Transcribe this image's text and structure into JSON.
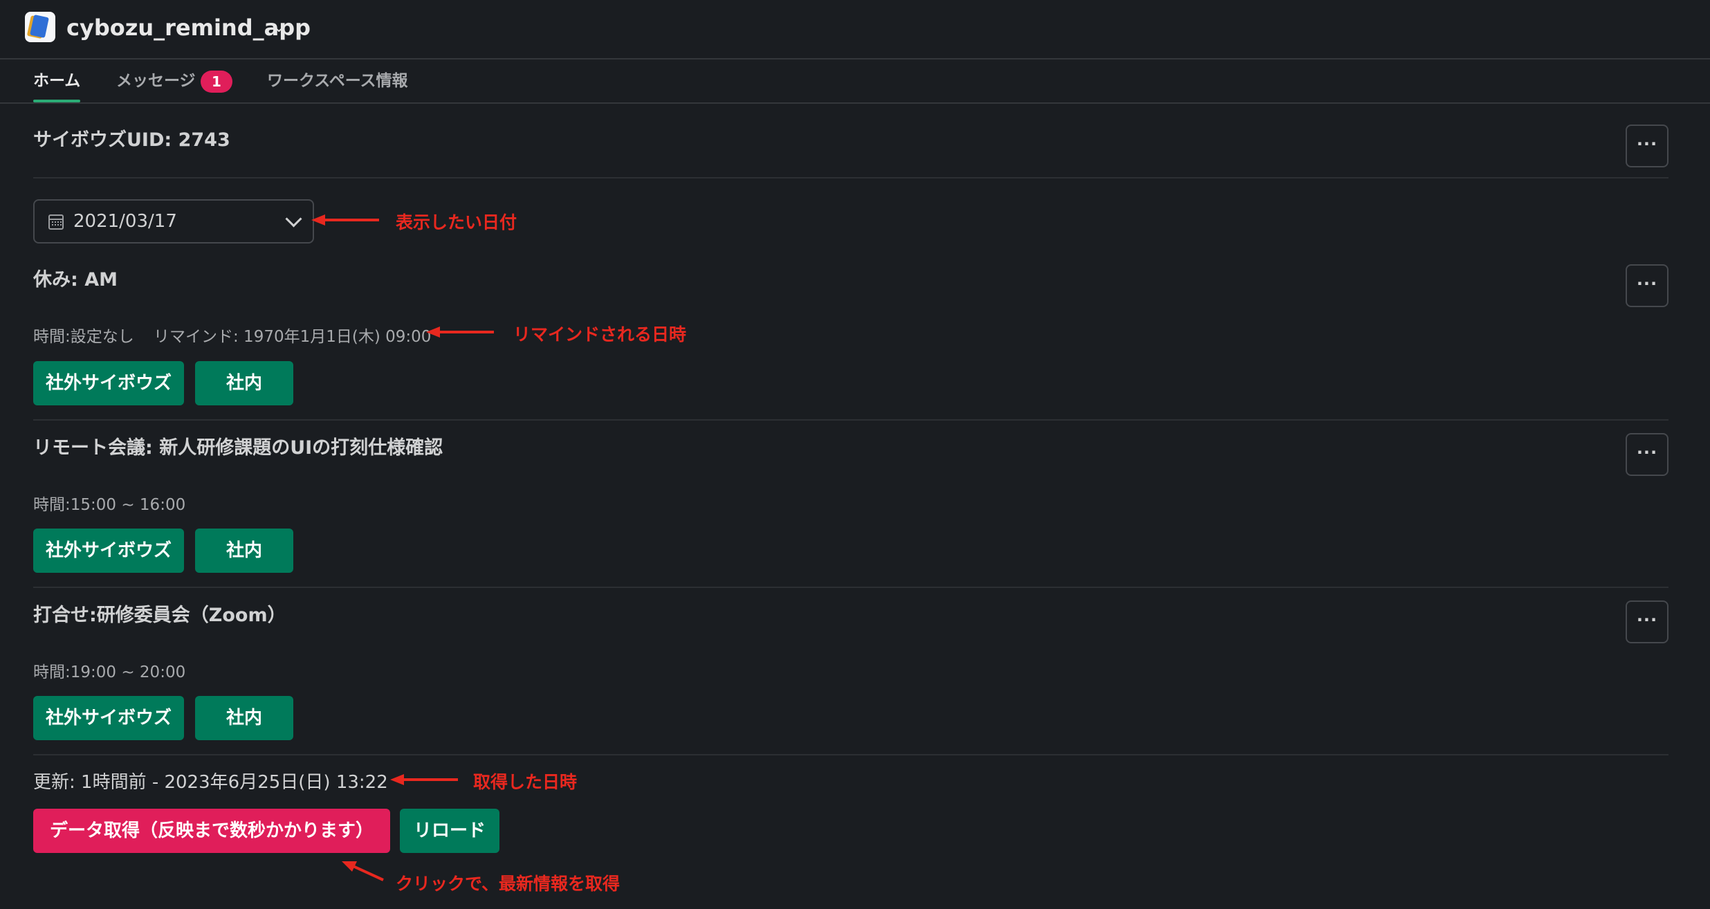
{
  "header": {
    "app_name": "cybozu_remind_app",
    "caret": "⌄"
  },
  "tabs": [
    {
      "label": "ホーム",
      "active": true
    },
    {
      "label": "メッセージ",
      "badge": "1"
    },
    {
      "label": "ワークスペース情報"
    }
  ],
  "user": {
    "uid_label": "サイボウズUID: 2743"
  },
  "more_label": "···",
  "datepicker": {
    "value": "2021/03/17"
  },
  "events": [
    {
      "title": "休み: AM",
      "time": "時間:設定なし",
      "remind": "リマインド: 1970年1月1日(木) 09:00",
      "buttons": [
        "社外サイボウズ",
        "社内"
      ]
    },
    {
      "title": "リモート会議: 新人研修課題のUIの打刻仕様確認",
      "time": "時間:15:00 ~ 16:00",
      "buttons": [
        "社外サイボウズ",
        "社内"
      ]
    },
    {
      "title": "打合せ:研修委員会（Zoom）",
      "time": "時間:19:00 ~ 20:00",
      "buttons": [
        "社外サイボウズ",
        "社内"
      ]
    }
  ],
  "footer": {
    "updated": "更新: 1時間前 - 2023年6月25日(日) 13:22",
    "fetch_button": "データ取得（反映まで数秒かかります）",
    "reload_button": "リロード"
  },
  "annotations": {
    "date": "表示したい日付",
    "remind": "リマインドされる日時",
    "updated": "取得した日時",
    "fetch": "クリックで、最新情報を取得"
  },
  "colors": {
    "background": "#1a1d21",
    "button_green": "#007a5a",
    "button_red": "#e01e5a",
    "badge": "#e01e5a",
    "tab_underline": "#2bac76",
    "annotation": "#e8281f"
  }
}
